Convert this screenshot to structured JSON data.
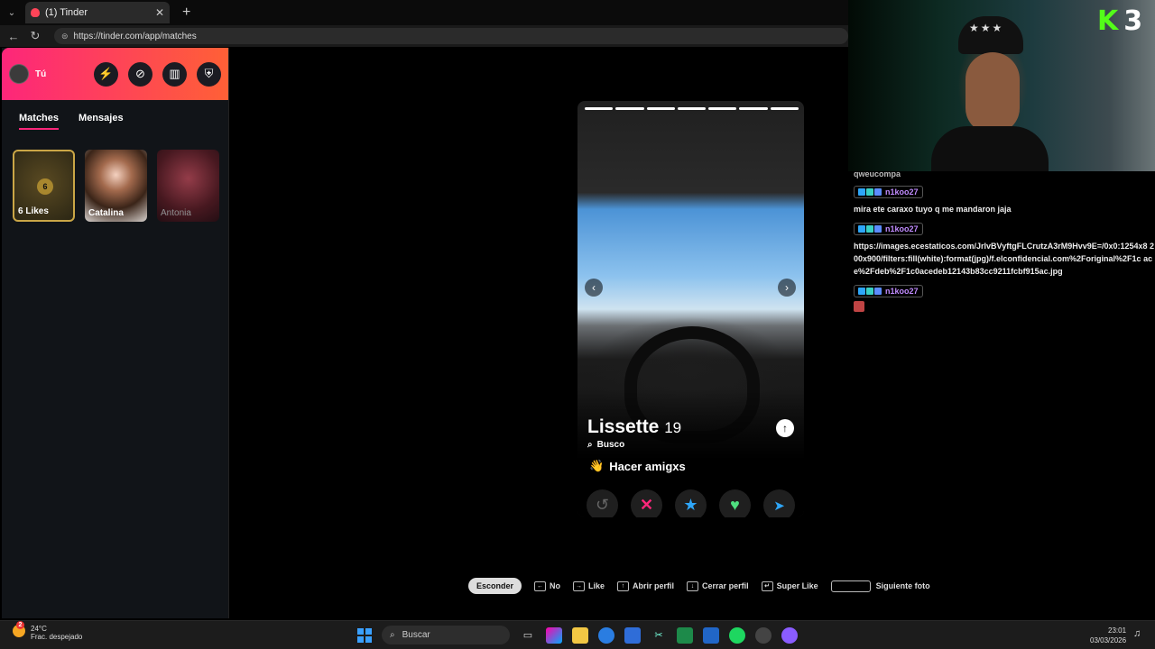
{
  "browser": {
    "tab_title": "(1) Tinder",
    "url": "https://tinder.com/app/matches",
    "new_tab": "+",
    "close": "✕"
  },
  "sidebar": {
    "user_label": "Tú",
    "tabs": [
      "Matches",
      "Mensajes"
    ],
    "likes_count": "6",
    "likes_label": "6 Likes",
    "matches": [
      "Catalina",
      "Antonia"
    ]
  },
  "profile": {
    "name": "Lissette",
    "age": "19",
    "looking_label": "Busco",
    "looking_value": "Hacer amigxs",
    "photo_count": 7,
    "photo_index": 7
  },
  "legend": {
    "hide": "Esconder",
    "no": "No",
    "like": "Like",
    "open": "Abrir perfil",
    "close": "Cerrar perfil",
    "superlike": "Super Like",
    "next": "Siguiente foto"
  },
  "stream": {
    "overlay_letter": "K",
    "overlay_number": "3"
  },
  "chat": {
    "cut_line": "qweucompa",
    "messages": [
      {
        "user": "n1koo27",
        "text": "mira ete caraxo tuyo q me mandaron jaja"
      },
      {
        "user": "n1koo27",
        "text": "https://images.ecestaticos.com/JrlvBVyftgFLCrutzA3rM9Hvv9E=/0x0:1254x8 200x900/filters:fill(white):format(jpg)/f.elconfidencial.com%2Foriginal%2F1c ace%2Fdeb%2F1c0acedeb12143b83cc9211fcbf915ac.jpg"
      },
      {
        "user": "n1koo27",
        "text": ""
      }
    ]
  },
  "taskbar": {
    "temp": "24°C",
    "weather": "Frac. despejado",
    "weather_badge": "2",
    "search": "Buscar",
    "time": "23:01",
    "date": "03/03/2026"
  }
}
